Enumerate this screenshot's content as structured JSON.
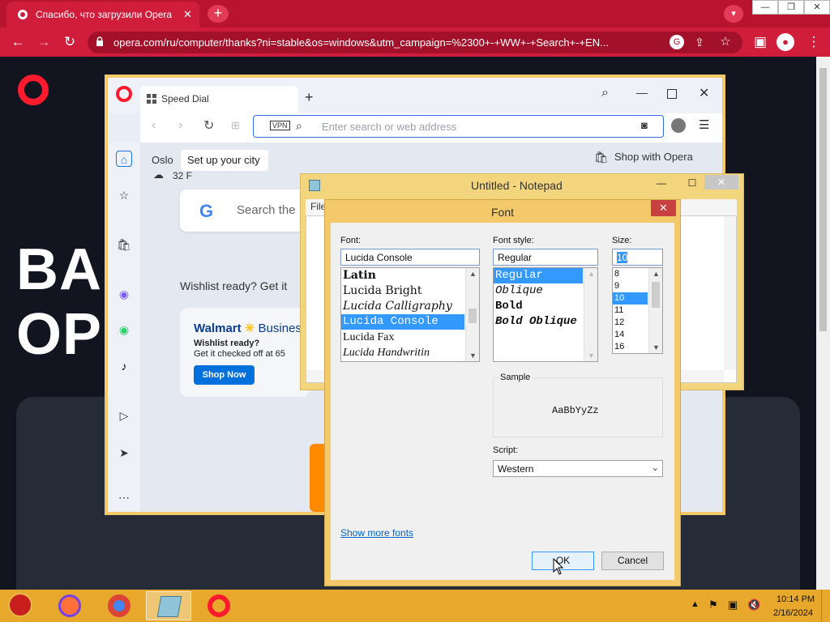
{
  "chrome": {
    "tab_title": "Спасибо, что загрузили Opera",
    "url": "opera.com/ru/computer/thanks?ni=stable&os=windows&utm_campaign=%2300+-+WW+-+Search+-+EN..."
  },
  "page": {
    "hero_line1": "BA",
    "hero_line2": "OP"
  },
  "opera": {
    "tab_label": "Speed Dial",
    "vpn_label": "VPN",
    "address_placeholder": "Enter search or web address",
    "weather_city": "Oslo",
    "tooltip": "Set up your city",
    "temperature": "32 F",
    "search_placeholder": "Search the",
    "wishlist_text": "Wishlist ready? Get it",
    "shop_label": "Shop with Opera",
    "walmart": {
      "brand": "Walmart",
      "brand_suffix": "Busines",
      "line1": "Wishlist ready?",
      "line2": "Get it checked off at 65",
      "button": "Shop Now"
    }
  },
  "notepad": {
    "title": "Untitled - Notepad",
    "menu_file": "File"
  },
  "font_dialog": {
    "title": "Font",
    "font_label": "Font:",
    "font_value": "Lucida Console",
    "fonts": [
      "Latin",
      "Lucida Bright",
      "Lucida Calligraphy",
      "Lucida Console",
      "Lucida Fax",
      "Lucida Handwritin"
    ],
    "selected_font_index": 3,
    "style_label": "Font style:",
    "style_value": "Regular",
    "styles": [
      "Regular",
      "Oblique",
      "Bold",
      "Bold Oblique"
    ],
    "size_label": "Size:",
    "size_value": "10",
    "sizes": [
      "8",
      "9",
      "10",
      "11",
      "12",
      "14",
      "16"
    ],
    "sample_label": "Sample",
    "sample_text": "AaBbYyZz",
    "script_label": "Script:",
    "script_value": "Western",
    "show_more": "Show more fonts",
    "ok": "OK",
    "cancel": "Cancel"
  },
  "taskbar": {
    "time": "10:14 PM",
    "date": "2/16/2024"
  },
  "colors": {
    "chrome_red": "#d11d3c",
    "opera_red": "#ff1b2d",
    "selection_blue": "#3399ff",
    "taskbar": "#e7a82c"
  }
}
